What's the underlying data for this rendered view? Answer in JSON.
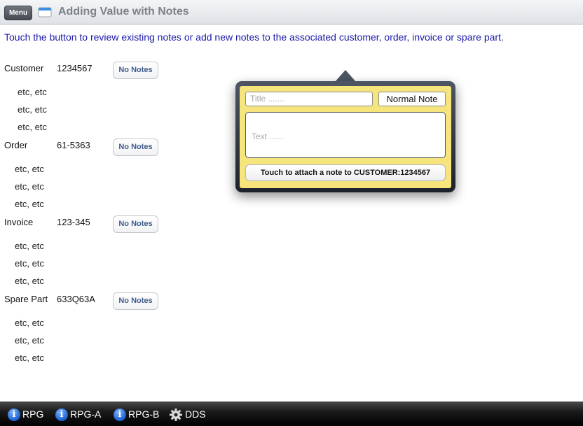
{
  "header": {
    "menu_label": "Menu",
    "title": "Adding Value with Notes"
  },
  "intro": "Touch the button to review existing notes or add new notes to the associated customer, order, invoice or spare part.",
  "records": [
    {
      "label": "Customer",
      "value": "1234567",
      "button": "No Notes",
      "details": [
        "etc, etc",
        "etc, etc",
        "etc, etc"
      ]
    },
    {
      "label": "Order",
      "value": "61-5363",
      "button": "No Notes",
      "details": [
        "etc, etc",
        "etc, etc",
        "etc, etc"
      ]
    },
    {
      "label": "Invoice",
      "value": "123-345",
      "button": "No Notes",
      "details": [
        "etc, etc",
        "etc, etc",
        "etc, etc"
      ]
    },
    {
      "label": "Spare Part",
      "value": "633Q63A",
      "button": "No Notes",
      "details": [
        "etc, etc",
        "etc, etc",
        "etc, etc"
      ]
    }
  ],
  "popover": {
    "title_placeholder": "Title .......",
    "note_type": "Normal Note",
    "text_placeholder": "Text ......",
    "attach_label": "Touch to attach a note to CUSTOMER:1234567"
  },
  "tabs": [
    {
      "label": "RPG",
      "icon": "info-icon"
    },
    {
      "label": "RPG-A",
      "icon": "info-icon"
    },
    {
      "label": "RPG-B",
      "icon": "info-icon"
    },
    {
      "label": "DDS",
      "icon": "gear-icon"
    }
  ],
  "colors": {
    "intro_text": "#1a1aa8",
    "note_panel": "#f6e47c",
    "button_text": "#3f5d8c"
  }
}
